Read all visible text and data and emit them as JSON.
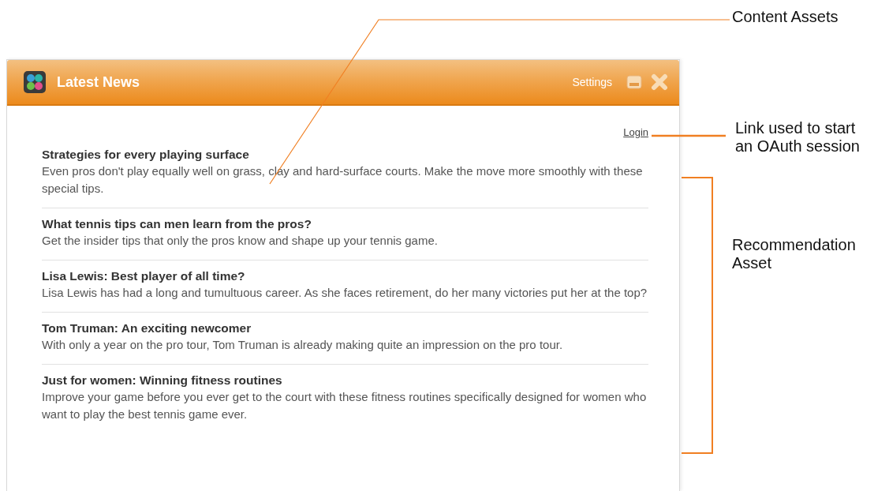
{
  "widget": {
    "title": "Latest News",
    "settings": "Settings",
    "login": "Login",
    "articles": [
      {
        "title": "Strategies for every playing surface",
        "summary": "Even pros don't play equally well on grass, clay and hard-surface courts. Make the move more smoothly with these special tips."
      },
      {
        "title": "What tennis tips can men learn from the pros?",
        "summary": "Get the insider tips that only the pros know and shape up your tennis game."
      },
      {
        "title": "Lisa Lewis: Best player of all time?",
        "summary": "Lisa Lewis has had a long and tumultuous career. As she faces retirement, do her many victories put her at the top?"
      },
      {
        "title": "Tom Truman: An exciting newcomer",
        "summary": "With only a year on the pro tour, Tom Truman is already making quite an impression on the pro tour."
      },
      {
        "title": "Just for women: Winning fitness routines",
        "summary": "Improve your game before you ever get to the court with these fitness routines specifically designed for women who want to play the best tennis game ever."
      }
    ]
  },
  "annotations": [
    {
      "kind": "leader",
      "text": "Content Assets"
    },
    {
      "kind": "line",
      "text": "Link used to start an OAuth session"
    },
    {
      "kind": "bracket",
      "text": "Recommendation Asset"
    }
  ]
}
